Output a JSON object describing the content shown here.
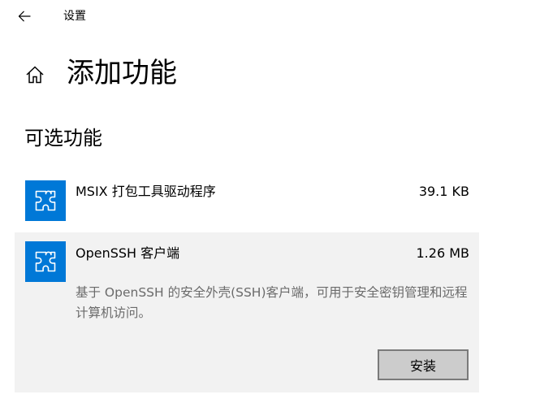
{
  "window": {
    "title": "设置"
  },
  "page": {
    "title": "添加功能",
    "section_title": "可选功能"
  },
  "features": [
    {
      "name": "MSIX 打包工具驱动程序",
      "size": "39.1 KB",
      "icon": "puzzle-icon",
      "selected": false
    },
    {
      "name": "OpenSSH 客户端",
      "size": "1.26 MB",
      "icon": "puzzle-icon",
      "selected": true,
      "description": "基于 OpenSSH 的安全外壳(SSH)客户端，可用于安全密钥管理和远程计算机访问。",
      "install_label": "安装"
    }
  ],
  "icons": {
    "back": "back-arrow-icon",
    "home": "home-icon"
  },
  "colors": {
    "accent": "#0078d7",
    "selected_background": "#f2f2f2",
    "description_text": "#6b6b6b",
    "button_background": "#cccccc",
    "button_border": "#7a7a7a"
  }
}
